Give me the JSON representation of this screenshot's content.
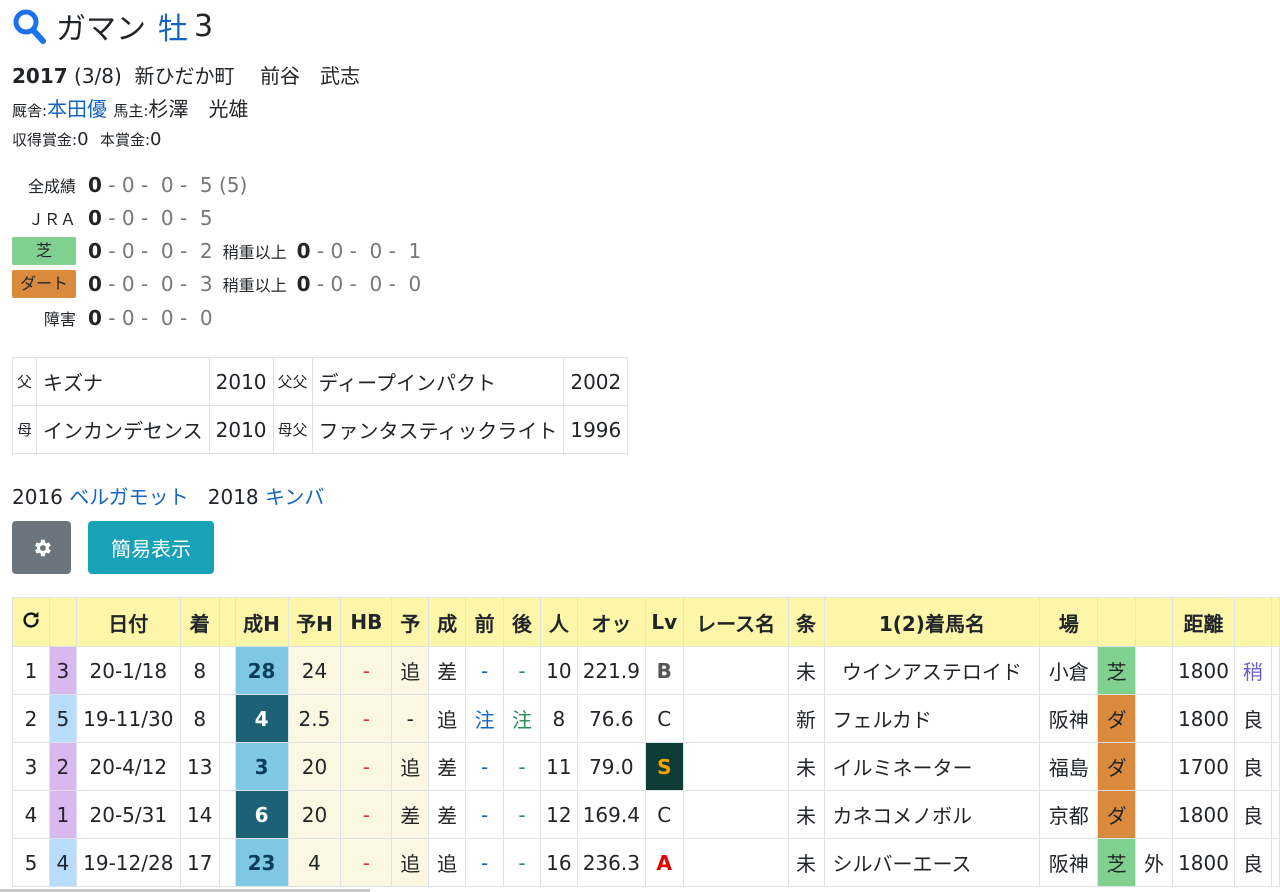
{
  "horse": {
    "name": "ガマン",
    "sex": "牡",
    "age": "3",
    "birth_year": "2017",
    "birth_date": "(3/8)",
    "location": "新ひだか町",
    "breeder": "前谷　武志",
    "trainer_label": "厩舎:",
    "trainer": "本田優",
    "owner_label": "馬主:",
    "owner": "杉澤　光雄",
    "earnings_label": "収得賞金:",
    "earnings": "0",
    "prize_label": "本賞金:",
    "prize": "0"
  },
  "records": [
    {
      "label": "全成績",
      "w": "0",
      "r": "0 -  0 -  5 (5)",
      "extra_label": "",
      "extra": ""
    },
    {
      "label": "ＪＲＡ",
      "w": "0",
      "r": "0 -  0 -  5",
      "extra_label": "",
      "extra": ""
    },
    {
      "label": "芝",
      "w": "0",
      "r": "0 -  0 -  2",
      "extra_label": "稍重以上",
      "extra_w": "0",
      "extra": "0 -  0 -  1"
    },
    {
      "label": "ダート",
      "w": "0",
      "r": "0 -  0 -  3",
      "extra_label": "稍重以上",
      "extra_w": "0",
      "extra": "0 -  0 -  0"
    },
    {
      "label": "障害",
      "w": "0",
      "r": "0 -  0 -  0",
      "extra_label": "",
      "extra": ""
    }
  ],
  "pedigree": {
    "sire_label": "父",
    "sire": "キズナ",
    "sire_year": "2010",
    "sire_sire_label": "父父",
    "sire_sire": "ディープインパクト",
    "sire_sire_year": "2002",
    "dam_label": "母",
    "dam": "インカンデセンス",
    "dam_year": "2010",
    "dam_sire_label": "母父",
    "dam_sire": "ファンタスティックライト",
    "dam_sire_year": "1996"
  },
  "siblings": [
    {
      "year": "2016",
      "name": "ベルガモット"
    },
    {
      "year": "2018",
      "name": "キンバ"
    }
  ],
  "buttons": {
    "gear": "gear-icon",
    "simple": "簡易表示"
  },
  "table": {
    "headers": [
      "",
      "",
      "日付",
      "着",
      "",
      "成H",
      "予H",
      "HB",
      "予",
      "成",
      "前",
      "後",
      "人",
      "オッ",
      "Lv",
      "レース名",
      "条",
      "1(2)着馬名",
      "場",
      "",
      "",
      "距離",
      "",
      ""
    ],
    "rows": [
      {
        "no": "1",
        "waku": "3",
        "date": "20-1/18",
        "chaku": "8",
        "seiH": "28",
        "yoH": "24",
        "hb": "-",
        "yo": "追",
        "sei": "差",
        "mae": "-",
        "ato": "-",
        "nin": "10",
        "odds": "221.9",
        "lv": "B",
        "race": "",
        "jou": "未",
        "winner": "ウインアステロイド",
        "ba": "小倉",
        "surface": "芝",
        "uchi": "",
        "dist": "1800",
        "cond": "稍"
      },
      {
        "no": "2",
        "waku": "5",
        "date": "19-11/30",
        "chaku": "8",
        "seiH": "4",
        "yoH": "2.5",
        "hb": "-",
        "yo": "-",
        "sei": "追",
        "mae": "注",
        "ato": "注",
        "nin": "8",
        "odds": "76.6",
        "lv": "C",
        "race": "",
        "jou": "新",
        "winner": "フェルカド",
        "ba": "阪神",
        "surface": "ダ",
        "uchi": "",
        "dist": "1800",
        "cond": "良"
      },
      {
        "no": "3",
        "waku": "2",
        "date": "20-4/12",
        "chaku": "13",
        "seiH": "3",
        "yoH": "20",
        "hb": "-",
        "yo": "追",
        "sei": "差",
        "mae": "-",
        "ato": "-",
        "nin": "11",
        "odds": "79.0",
        "lv": "S",
        "race": "",
        "jou": "未",
        "winner": "イルミネーター",
        "ba": "福島",
        "surface": "ダ",
        "uchi": "",
        "dist": "1700",
        "cond": "良"
      },
      {
        "no": "4",
        "waku": "1",
        "date": "20-5/31",
        "chaku": "14",
        "seiH": "6",
        "yoH": "20",
        "hb": "-",
        "yo": "差",
        "sei": "差",
        "mae": "-",
        "ato": "-",
        "nin": "12",
        "odds": "169.4",
        "lv": "C",
        "race": "",
        "jou": "未",
        "winner": "カネコメノボル",
        "ba": "京都",
        "surface": "ダ",
        "uchi": "",
        "dist": "1800",
        "cond": "良"
      },
      {
        "no": "5",
        "waku": "4",
        "date": "19-12/28",
        "chaku": "17",
        "seiH": "23",
        "yoH": "4",
        "hb": "-",
        "yo": "追",
        "sei": "追",
        "mae": "-",
        "ato": "-",
        "nin": "16",
        "odds": "236.3",
        "lv": "A",
        "race": "",
        "jou": "未",
        "winner": "シルバーエース",
        "ba": "阪神",
        "surface": "芝",
        "uchi": "外",
        "dist": "1800",
        "cond": "良"
      }
    ]
  },
  "colors": {
    "accent": "#1565c0",
    "header": "#fbf6a8",
    "turf": "#80d08f",
    "dirt": "#d98a3d",
    "button_gray": "#6c757d",
    "button_teal": "#17a2b8"
  }
}
